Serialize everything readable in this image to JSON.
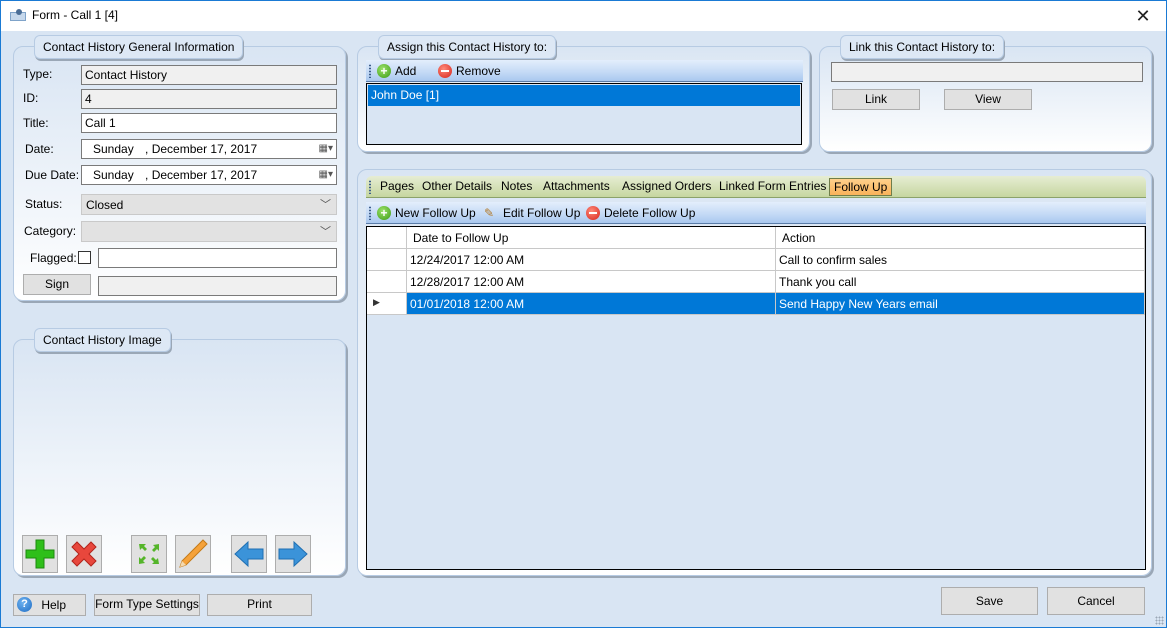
{
  "window": {
    "title": "Form - Call 1 [4]",
    "close_icon": "close-icon"
  },
  "general_info": {
    "legend": "Contact History General Information",
    "type_label": "Type:",
    "type_value": "Contact History",
    "id_label": "ID:",
    "id_value": "4",
    "title_label": "Title:",
    "title_value": "Call 1",
    "date_label": "Date:",
    "date_day": "Sunday",
    "date_value": ", December 17, 2017",
    "due_date_label": "Due Date:",
    "due_date_day": "Sunday",
    "due_date_value": ", December 17, 2017",
    "status_label": "Status:",
    "status_value": "Closed",
    "category_label": "Category:",
    "category_value": "",
    "flagged_label": "Flagged:",
    "flagged_checked": false,
    "flagged_note": "",
    "sign_label": "Sign",
    "sign_value": ""
  },
  "image_panel": {
    "legend": "Contact History Image",
    "buttons": [
      "add-image",
      "delete-image",
      "fit-image",
      "edit-image",
      "previous-image",
      "next-image"
    ]
  },
  "assign_panel": {
    "legend": "Assign this Contact History to:",
    "add_label": "Add",
    "remove_label": "Remove",
    "items": [
      "John Doe [1]"
    ]
  },
  "link_panel": {
    "legend": "Link this Contact History to:",
    "link_value": "",
    "link_label": "Link",
    "view_label": "View"
  },
  "tabs": {
    "items": [
      "Pages",
      "Other Details",
      "Notes",
      "Attachments",
      "Assigned Orders",
      "Linked Form Entries",
      "Follow Up"
    ],
    "active": "Follow Up"
  },
  "follow_up": {
    "new_label": "New Follow Up",
    "edit_label": "Edit Follow Up",
    "delete_label": "Delete Follow Up",
    "columns": [
      "Date to Follow Up",
      "Action"
    ],
    "rows": [
      {
        "date": "12/24/2017 12:00 AM",
        "action": "Call to confirm sales"
      },
      {
        "date": "12/28/2017 12:00 AM",
        "action": "Thank you call"
      },
      {
        "date": "01/01/2018 12:00 AM",
        "action": "Send Happy New Years email"
      }
    ],
    "selected_row": 2
  },
  "footer": {
    "help_label": "Help",
    "form_type_settings_label": "Form Type Settings",
    "print_label": "Print",
    "save_label": "Save",
    "cancel_label": "Cancel"
  },
  "colors": {
    "selection": "#0078d7",
    "active_tab": "#f9b25a",
    "background": "#d9e5f3"
  }
}
